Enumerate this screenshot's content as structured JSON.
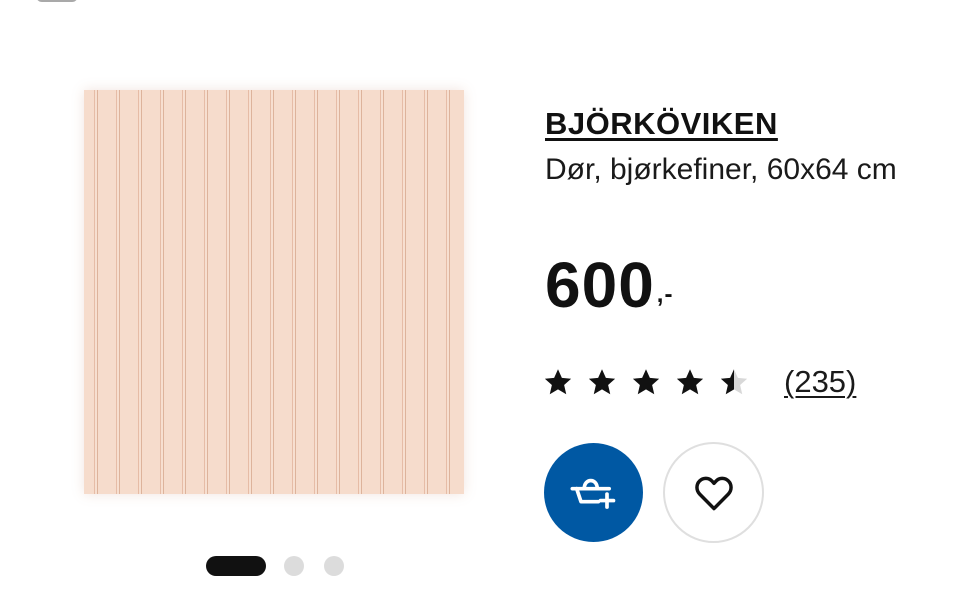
{
  "product": {
    "name": "BJÖRKÖVIKEN",
    "description": "Dør, bjørkefiner, 60x64 cm",
    "price": "600",
    "price_suffix": ",-"
  },
  "rating": {
    "stars": 4.5,
    "max_stars": 5,
    "review_count": "(235)"
  },
  "carousel": {
    "image_count": 3,
    "active_index": 0
  },
  "actions": {
    "add_to_cart_icon": "cart-add-icon",
    "favourite_icon": "heart-icon"
  },
  "colors": {
    "accent": "#0058a3",
    "text": "#111111",
    "dot_inactive": "#dcdcdc"
  }
}
